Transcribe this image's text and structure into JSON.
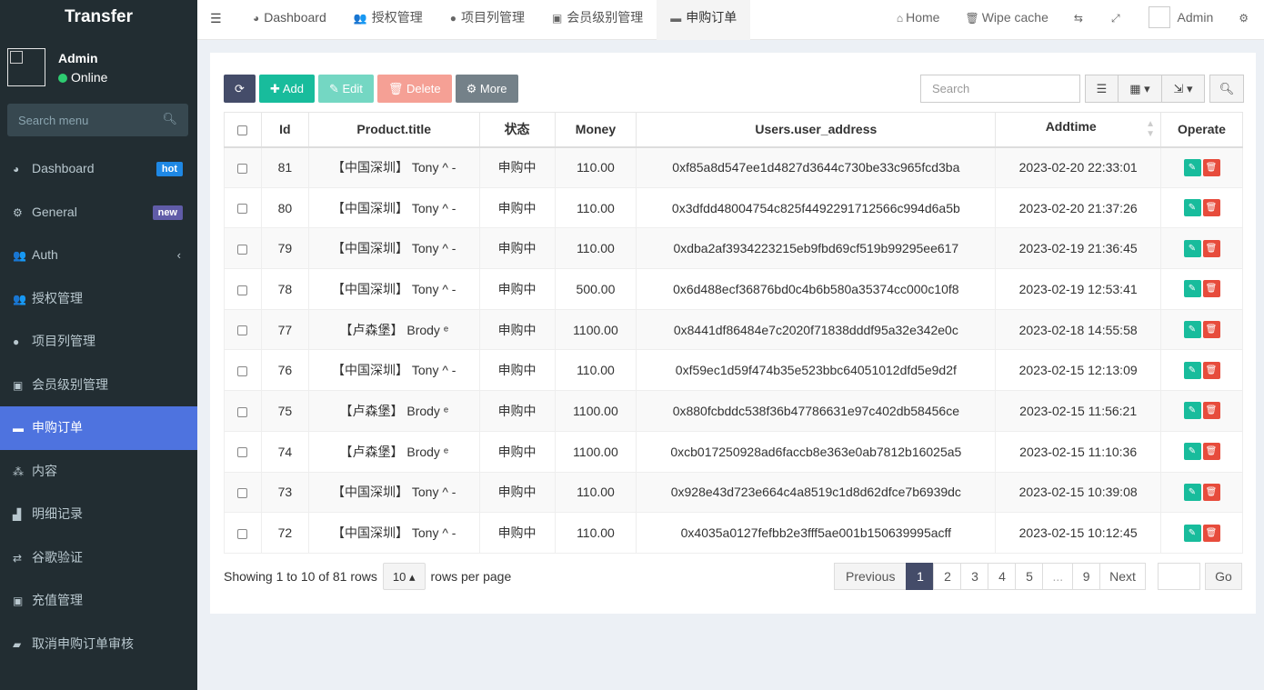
{
  "brand": "Transfer",
  "user": {
    "name": "Admin",
    "status": "Online"
  },
  "search_menu": {
    "placeholder": "Search menu"
  },
  "menu": [
    {
      "label": "Dashboard",
      "icon": "dashboard-icon",
      "glyph": "◕",
      "badge": "hot"
    },
    {
      "label": "General",
      "icon": "cogs-icon",
      "glyph": "⚙",
      "badge": "new"
    },
    {
      "label": "Auth",
      "icon": "group-icon",
      "glyph": "👥",
      "chevron": "‹"
    },
    {
      "label": "授权管理",
      "icon": "group-icon",
      "glyph": "👥"
    },
    {
      "label": "项目列管理",
      "icon": "circle-icon",
      "glyph": "●"
    },
    {
      "label": "会员级别管理",
      "icon": "calendar-check-icon",
      "glyph": "▣"
    },
    {
      "label": "申购订单",
      "icon": "credit-card-icon",
      "glyph": "▬",
      "active": true
    },
    {
      "label": "内容",
      "icon": "cubes-icon",
      "glyph": "⁂"
    },
    {
      "label": "明细记录",
      "icon": "area-chart-icon",
      "glyph": "▟"
    },
    {
      "label": "谷歌验证",
      "icon": "refresh-icon",
      "glyph": "⇄"
    },
    {
      "label": "充值管理",
      "icon": "calendar-check-icon",
      "glyph": "▣"
    },
    {
      "label": "取消申购订单审核",
      "icon": "ticket-icon",
      "glyph": "▰"
    }
  ],
  "header": {
    "tabs": [
      {
        "label": "Dashboard",
        "glyph": "◕",
        "icon": "dashboard-icon"
      },
      {
        "label": "授权管理",
        "glyph": "👥",
        "icon": "group-icon"
      },
      {
        "label": "项目列管理",
        "glyph": "●",
        "icon": "circle-icon"
      },
      {
        "label": "会员级别管理",
        "glyph": "▣",
        "icon": "calendar-check-icon"
      },
      {
        "label": "申购订单",
        "glyph": "▬",
        "icon": "credit-card-icon",
        "active": true
      }
    ],
    "home": "Home",
    "wipe": "Wipe cache",
    "admin": "Admin"
  },
  "toolbar": {
    "add": "Add",
    "edit": "Edit",
    "delete": "Delete",
    "more": "More",
    "search_placeholder": "Search"
  },
  "table": {
    "columns": [
      "Id",
      "Product.title",
      "状态",
      "Money",
      "Users.user_address",
      "Addtime",
      "Operate"
    ],
    "rows": [
      {
        "id": "81",
        "title": "【中国深圳】 Tony ^ -",
        "status": "申购中",
        "money": "110.00",
        "address": "0xf85a8d547ee1d4827d3644c730be33c965fcd3ba",
        "time": "2023-02-20 22:33:01"
      },
      {
        "id": "80",
        "title": "【中国深圳】 Tony ^ -",
        "status": "申购中",
        "money": "110.00",
        "address": "0x3dfdd48004754c825f4492291712566c994d6a5b",
        "time": "2023-02-20 21:37:26"
      },
      {
        "id": "79",
        "title": "【中国深圳】 Tony ^ -",
        "status": "申购中",
        "money": "110.00",
        "address": "0xdba2af3934223215eb9fbd69cf519b99295ee617",
        "time": "2023-02-19 21:36:45"
      },
      {
        "id": "78",
        "title": "【中国深圳】 Tony ^ -",
        "status": "申购中",
        "money": "500.00",
        "address": "0x6d488ecf36876bd0c4b6b580a35374cc000c10f8",
        "time": "2023-02-19 12:53:41"
      },
      {
        "id": "77",
        "title": "【卢森堡】 Brody ᵉ",
        "status": "申购中",
        "money": "1100.00",
        "address": "0x8441df86484e7c2020f71838dddf95a32e342e0c",
        "time": "2023-02-18 14:55:58"
      },
      {
        "id": "76",
        "title": "【中国深圳】 Tony ^ -",
        "status": "申购中",
        "money": "110.00",
        "address": "0xf59ec1d59f474b35e523bbc64051012dfd5e9d2f",
        "time": "2023-02-15 12:13:09"
      },
      {
        "id": "75",
        "title": "【卢森堡】 Brody ᵉ",
        "status": "申购中",
        "money": "1100.00",
        "address": "0x880fcbddc538f36b47786631e97c402db58456ce",
        "time": "2023-02-15 11:56:21"
      },
      {
        "id": "74",
        "title": "【卢森堡】 Brody ᵉ",
        "status": "申购中",
        "money": "1100.00",
        "address": "0xcb017250928ad6faccb8e363e0ab7812b16025a5",
        "time": "2023-02-15 11:10:36"
      },
      {
        "id": "73",
        "title": "【中国深圳】 Tony ^ -",
        "status": "申购中",
        "money": "110.00",
        "address": "0x928e43d723e664c4a8519c1d8d62dfce7b6939dc",
        "time": "2023-02-15 10:39:08"
      },
      {
        "id": "72",
        "title": "【中国深圳】 Tony ^ -",
        "status": "申购中",
        "money": "110.00",
        "address": "0x4035a0127fefbb2e3fff5ae001b150639995acff",
        "time": "2023-02-15 10:12:45"
      }
    ]
  },
  "footer": {
    "showing": "Showing 1 to 10 of 81 rows",
    "page_size": "10",
    "rows_per_page": "rows per page"
  },
  "pagination": [
    "Previous",
    "1",
    "2",
    "3",
    "4",
    "5",
    "...",
    "9",
    "Next"
  ],
  "go": "Go",
  "colors": {
    "sidebar": "#222d32",
    "active": "#4e73df",
    "success": "#18bc9c",
    "danger": "#e74c3c"
  }
}
